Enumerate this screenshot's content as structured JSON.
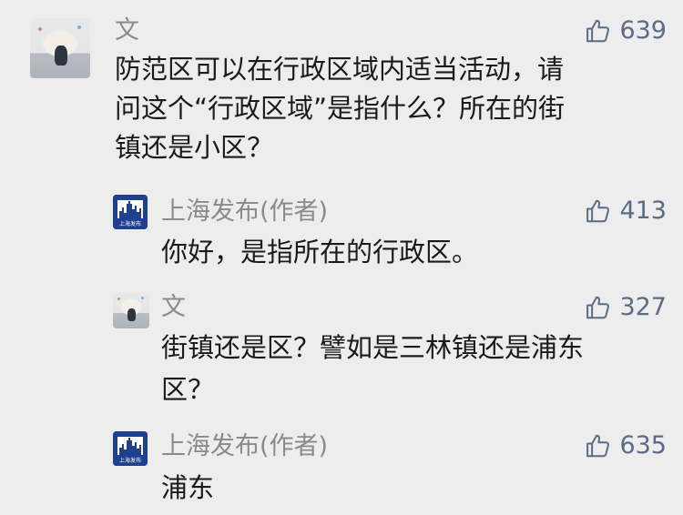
{
  "comments": [
    {
      "author": "文",
      "avatar_icon": "baby-photo-avatar",
      "likes": "639",
      "lines": [
        "防范区可以在行政区域内适当活动，请",
        "问这个“行政区域”是指什么？所在的街",
        "镇还是小区？"
      ]
    },
    {
      "author": "上海发布(作者)",
      "avatar_icon": "shanghai-skyline-logo-avatar",
      "likes": "413",
      "lines": [
        "你好，是指所在的行政区。"
      ]
    },
    {
      "author": "文",
      "avatar_icon": "baby-photo-avatar",
      "likes": "327",
      "lines": [
        "街镇还是区？譬如是三林镇还是浦东",
        "区？"
      ]
    },
    {
      "author": "上海发布(作者)",
      "avatar_icon": "shanghai-skyline-logo-avatar",
      "likes": "635",
      "lines": [
        "浦东"
      ]
    }
  ],
  "logo_text": "上海发布",
  "colors": {
    "background": "#ededed",
    "name": "#8a8a8a",
    "text": "#1a1a1a",
    "like": "#5b6b86",
    "logo": "#1f3f8f"
  }
}
